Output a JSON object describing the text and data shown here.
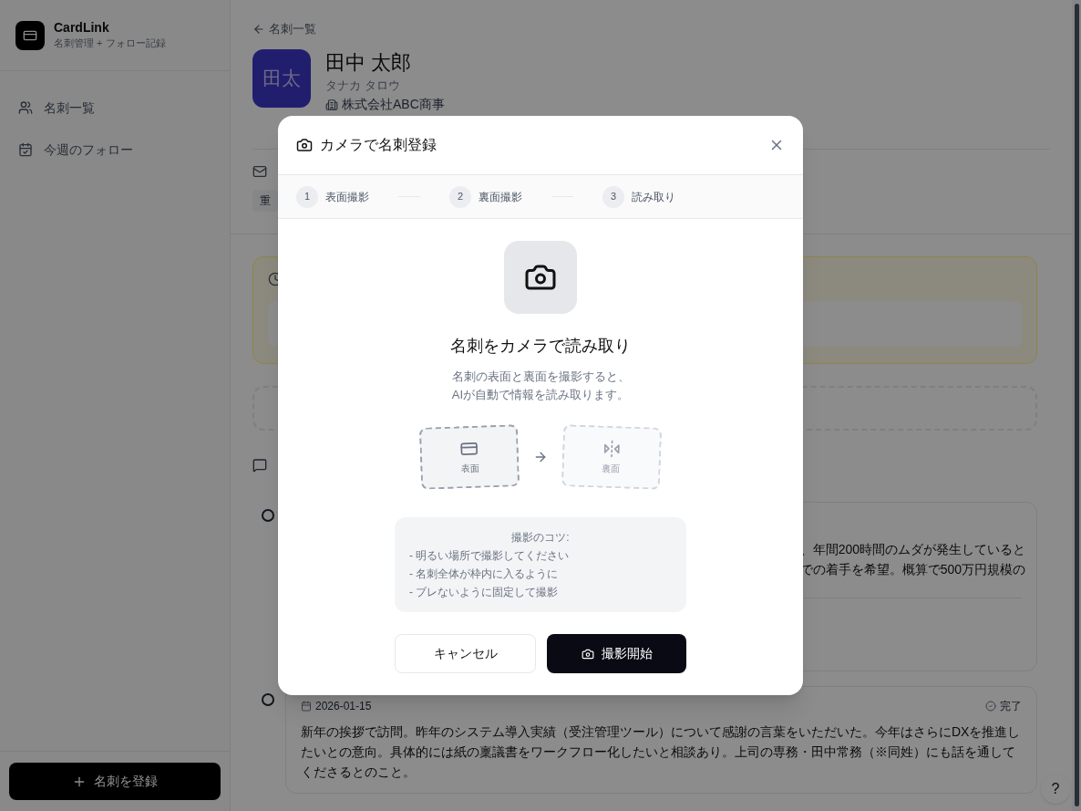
{
  "sidebar": {
    "app_name": "CardLink",
    "app_subtitle": "名刺管理 + フォロー記録",
    "nav_items": [
      {
        "label": "名刺一覧"
      },
      {
        "label": "今週のフォロー"
      }
    ],
    "register_button": "名刺を登録"
  },
  "contact": {
    "back_link": "名刺一覧",
    "initials": "田太",
    "name": "田中 太郎",
    "kana": "タナカ タロウ",
    "company": "株式会社ABC商事",
    "tag": "重"
  },
  "timeline": [
    {
      "lines": [
        "、年間200時間のムダが発生していると",
        "での着手を希望。概算で500万円規模の"
      ]
    },
    {
      "date": "2026-01-15",
      "status": "完了",
      "text": "新年の挨拶で訪問。昨年のシステム導入実績（受注管理ツール）について感謝の言葉をいただいた。今年はさらにDXを推進したいとの意向。具体的には紙の稟議書をワークフロー化したいと相談あり。上司の専務・田中常務（※同姓）にも話を通してくださるとのこと。"
    }
  ],
  "dialog": {
    "title": "カメラで名刺登録",
    "steps": [
      {
        "number": "1",
        "label": "表面撮影"
      },
      {
        "number": "2",
        "label": "裏面撮影"
      },
      {
        "number": "3",
        "label": "読み取り"
      }
    ],
    "heading": "名刺をカメラで読み取り",
    "description": [
      "名刺の表面と裏面を撮影すると、",
      "AIが自動で情報を読み取ります。"
    ],
    "cards": [
      {
        "label": "表面",
        "active": true
      },
      {
        "label": "裏面",
        "active": false
      }
    ],
    "tips_title": "撮影のコツ:",
    "tips": [
      "- 明るい場所で撮影してください",
      "- 名刺全体が枠内に入るように",
      "- ブレないように固定して撮影"
    ],
    "cancel_button": "キャンセル",
    "start_button": "撮影開始"
  },
  "help_button": "?"
}
